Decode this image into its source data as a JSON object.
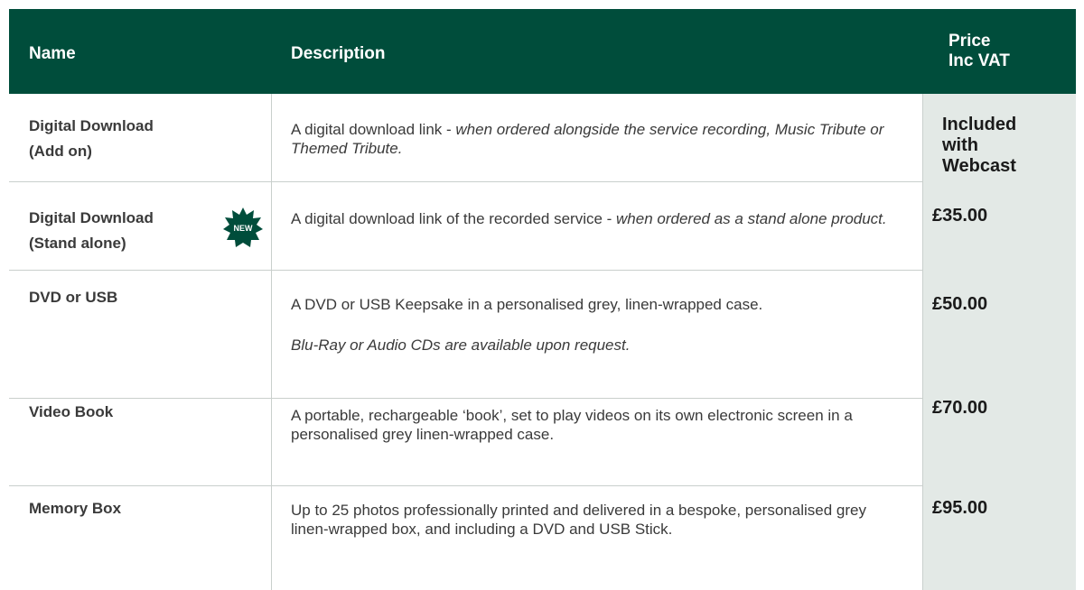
{
  "header": {
    "name": "Name",
    "description": "Description",
    "price": "Price\nInc VAT"
  },
  "rows": [
    {
      "name_line1": "Digital Download",
      "name_line2": "(Add on)",
      "desc_plain": "A digital download link - ",
      "desc_italic": "when ordered alongside the service recording, Music Tribute or Themed Tribute.",
      "price_line1": "Included",
      "price_line2": "with",
      "price_line3": "Webcast"
    },
    {
      "name_line1": "Digital Download",
      "name_line2": "(Stand alone)",
      "badge": "NEW",
      "desc_plain": "A digital download link of the recorded service - ",
      "desc_italic": "when ordered as a stand alone product.",
      "price": "£35.00"
    },
    {
      "name": "DVD or USB",
      "desc_plain": "A DVD or USB Keepsake in a personalised grey, linen-wrapped case.",
      "desc_italic": "Blu-Ray or Audio CDs are available upon request.",
      "price": "£50.00"
    },
    {
      "name": "Video Book",
      "desc_plain": "A portable, rechargeable ‘book’, set to play videos on its own electronic screen in a personalised grey linen-wrapped case.",
      "price": "£70.00"
    },
    {
      "name": "Memory Box",
      "desc_plain": "Up to 25 photos professionally printed and delivered in a bespoke, personalised grey linen-wrapped box, and including  a DVD and USB Stick.",
      "price": "£95.00"
    }
  ],
  "colors": {
    "header_bg": "#004d3b",
    "price_col_bg": "#e3e9e6",
    "badge": "#004d3b"
  }
}
